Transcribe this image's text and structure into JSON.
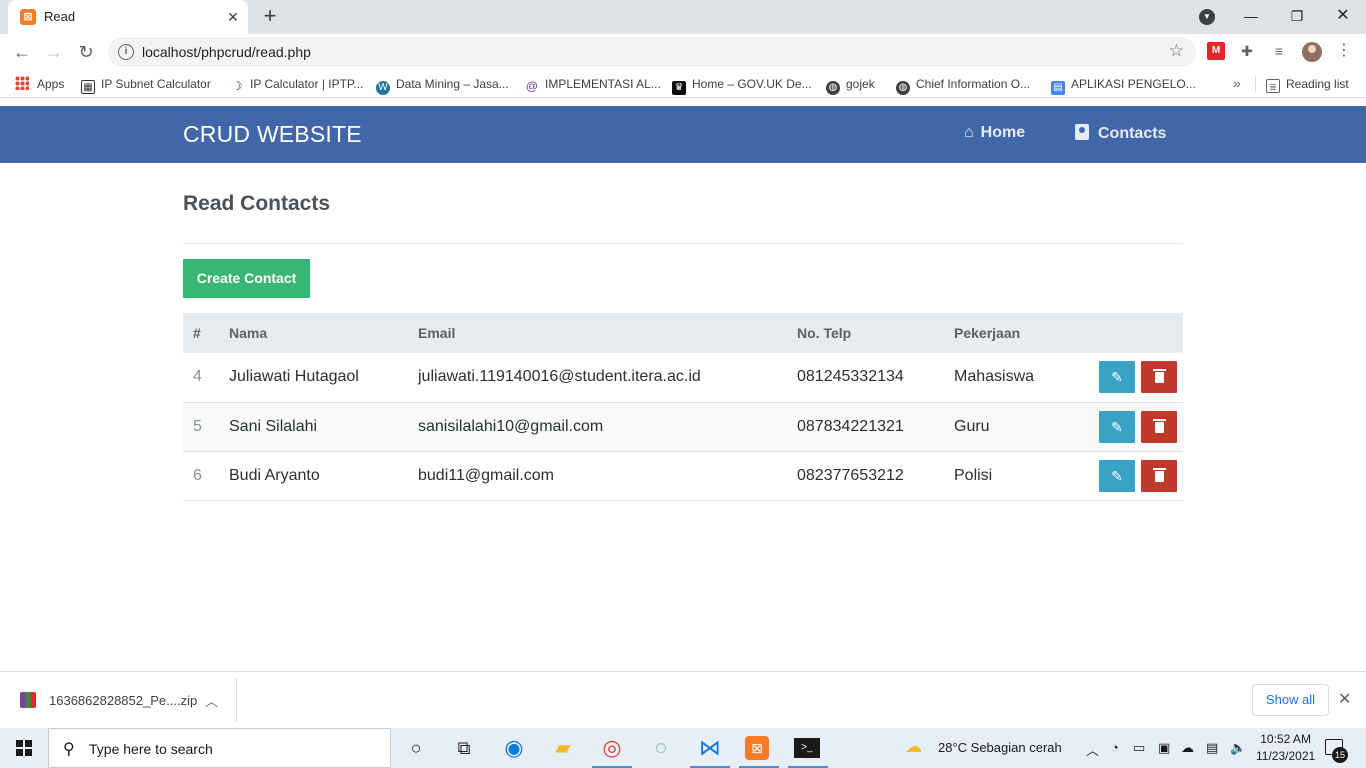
{
  "browser": {
    "tab_title": "Read",
    "tab_favicon": "xampp-icon",
    "url": "localhost/phpcrud/read.php",
    "bookmarks": [
      {
        "label": "Apps",
        "icon": "apps-grid-icon"
      },
      {
        "label": "IP Subnet Calculator",
        "icon": "calculator-icon"
      },
      {
        "label": "IP Calculator | IPTP...",
        "icon": "moon-icon"
      },
      {
        "label": "Data Mining – Jasa...",
        "icon": "wordpress-icon"
      },
      {
        "label": "IMPLEMENTASI AL...",
        "icon": "at-icon"
      },
      {
        "label": "Home – GOV.UK De...",
        "icon": "crown-icon"
      },
      {
        "label": "gojek",
        "icon": "globe-icon"
      },
      {
        "label": "Chief Information O...",
        "icon": "globe-icon"
      },
      {
        "label": "APLIKASI PENGELO...",
        "icon": "doc-icon"
      }
    ],
    "reading_list": "Reading list"
  },
  "site": {
    "brand": "CRUD WEBSITE",
    "nav": [
      {
        "label": "Home",
        "icon": "home-icon"
      },
      {
        "label": "Contacts",
        "icon": "address-book-icon"
      }
    ]
  },
  "page": {
    "title": "Read Contacts",
    "create_button": "Create Contact",
    "table": {
      "headers": [
        "#",
        "Nama",
        "Email",
        "No. Telp",
        "Pekerjaan"
      ],
      "rows": [
        {
          "id": "4",
          "nama": "Juliawati Hutagaol",
          "email": "juliawati.119140016@student.itera.ac.id",
          "telp": "081245332134",
          "pekerjaan": "Mahasiswa"
        },
        {
          "id": "5",
          "nama": "Sani Silalahi",
          "email": "sanisilalahi10@gmail.com",
          "telp": "087834221321",
          "pekerjaan": "Guru"
        },
        {
          "id": "6",
          "nama": "Budi Aryanto",
          "email": "budi11@gmail.com",
          "telp": "082377653212",
          "pekerjaan": "Polisi"
        }
      ]
    }
  },
  "download_bar": {
    "filename": "1636862828852_Pe....zip",
    "show_all": "Show all"
  },
  "taskbar": {
    "search_placeholder": "Type here to search",
    "weather": "28°C  Sebagian cerah",
    "time": "10:52 AM",
    "date": "11/23/2021",
    "notifications": "15"
  },
  "colors": {
    "navbar": "#4267a8",
    "create_button": "#38b673",
    "edit_button": "#38a3c4",
    "delete_button": "#c0392b",
    "table_header": "#e9ecef"
  }
}
